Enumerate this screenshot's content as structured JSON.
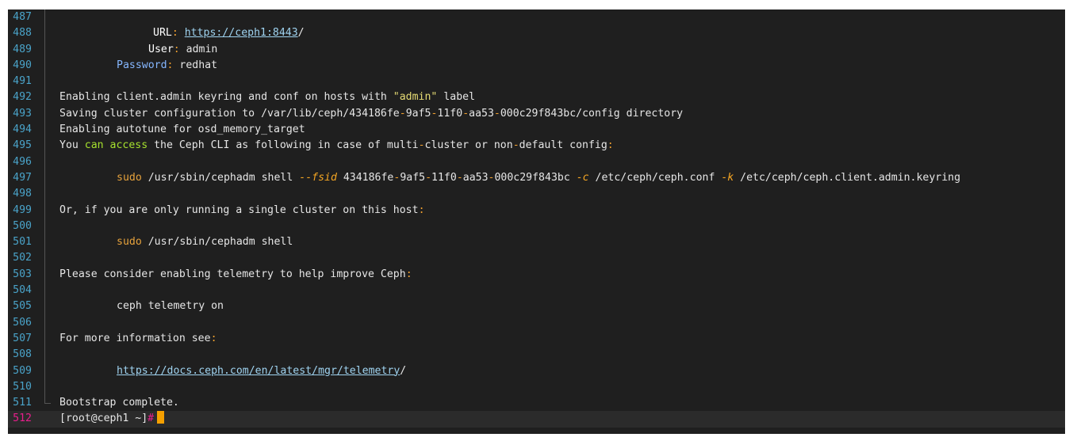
{
  "terminal": {
    "colors": {
      "background": "#1f1f1f",
      "line_number": "#4aa3c9",
      "current_line_number": "#e91e8c",
      "cursor": "#f5a000"
    },
    "lines": {
      "l487": {
        "num": "487"
      },
      "l488": {
        "num": "488",
        "label": "URL",
        "colon": ":",
        "link": "https://ceph1:8443",
        "trail": "/"
      },
      "l489": {
        "num": "489",
        "label": "User",
        "colon": ":",
        "value": " admin"
      },
      "l490": {
        "num": "490",
        "label": "Password",
        "colon": ":",
        "value": " redhat"
      },
      "l491": {
        "num": "491"
      },
      "l492": {
        "num": "492",
        "a": "Enabling client.admin keyring and conf on hosts with ",
        "str": "\"admin\"",
        "b": " label"
      },
      "l493": {
        "num": "493",
        "a": "Saving cluster configuration to /var/lib/ceph/434186fe",
        "d1": "-",
        "b": "9af5",
        "d2": "-",
        "c": "11f0",
        "d3": "-",
        "d": "aa53",
        "d4": "-",
        "e": "000c29f843bc/config directory"
      },
      "l494": {
        "num": "494",
        "text": "Enabling autotune for osd_memory_target"
      },
      "l495": {
        "num": "495",
        "a": "You ",
        "green": "can access",
        "b": " the Ceph CLI as following in case of multi",
        "d1": "-",
        "c": "cluster or non",
        "d2": "-",
        "d": "default config",
        "colon": ":"
      },
      "l496": {
        "num": "496"
      },
      "l497": {
        "num": "497",
        "sudo": "sudo",
        "a": " /usr/sbin/cephadm shell ",
        "fsid_flag": "--fsid",
        "b": " 434186fe",
        "d1": "-",
        "c": "9af5",
        "d2": "-",
        "d": "11f0",
        "d3": "-",
        "e": "aa53",
        "d4": "-",
        "f": "000c29f843bc ",
        "c_flag": "-c",
        "g": " /etc/ceph/ceph.conf ",
        "k_flag": "-k",
        "h": " /etc/ceph/ceph.client.admin.keyring"
      },
      "l498": {
        "num": "498"
      },
      "l499": {
        "num": "499",
        "text": "Or, if you are only running a single cluster on this host",
        "colon": ":"
      },
      "l500": {
        "num": "500"
      },
      "l501": {
        "num": "501",
        "sudo": "sudo",
        "a": " /usr/sbin/cephadm shell"
      },
      "l502": {
        "num": "502"
      },
      "l503": {
        "num": "503",
        "text": "Please consider enabling telemetry to help improve Ceph",
        "colon": ":"
      },
      "l504": {
        "num": "504"
      },
      "l505": {
        "num": "505",
        "text": "ceph telemetry on"
      },
      "l506": {
        "num": "506"
      },
      "l507": {
        "num": "507",
        "text": "For more information see",
        "colon": ":"
      },
      "l508": {
        "num": "508"
      },
      "l509": {
        "num": "509",
        "link": "https://docs.ceph.com/en/latest/mgr/telemetry",
        "trail": "/"
      },
      "l510": {
        "num": "510"
      },
      "l511": {
        "num": "511",
        "text": "Bootstrap complete."
      },
      "l512": {
        "num": "512",
        "prompt": "[root@ceph1 ~]",
        "hash": "#"
      }
    }
  }
}
